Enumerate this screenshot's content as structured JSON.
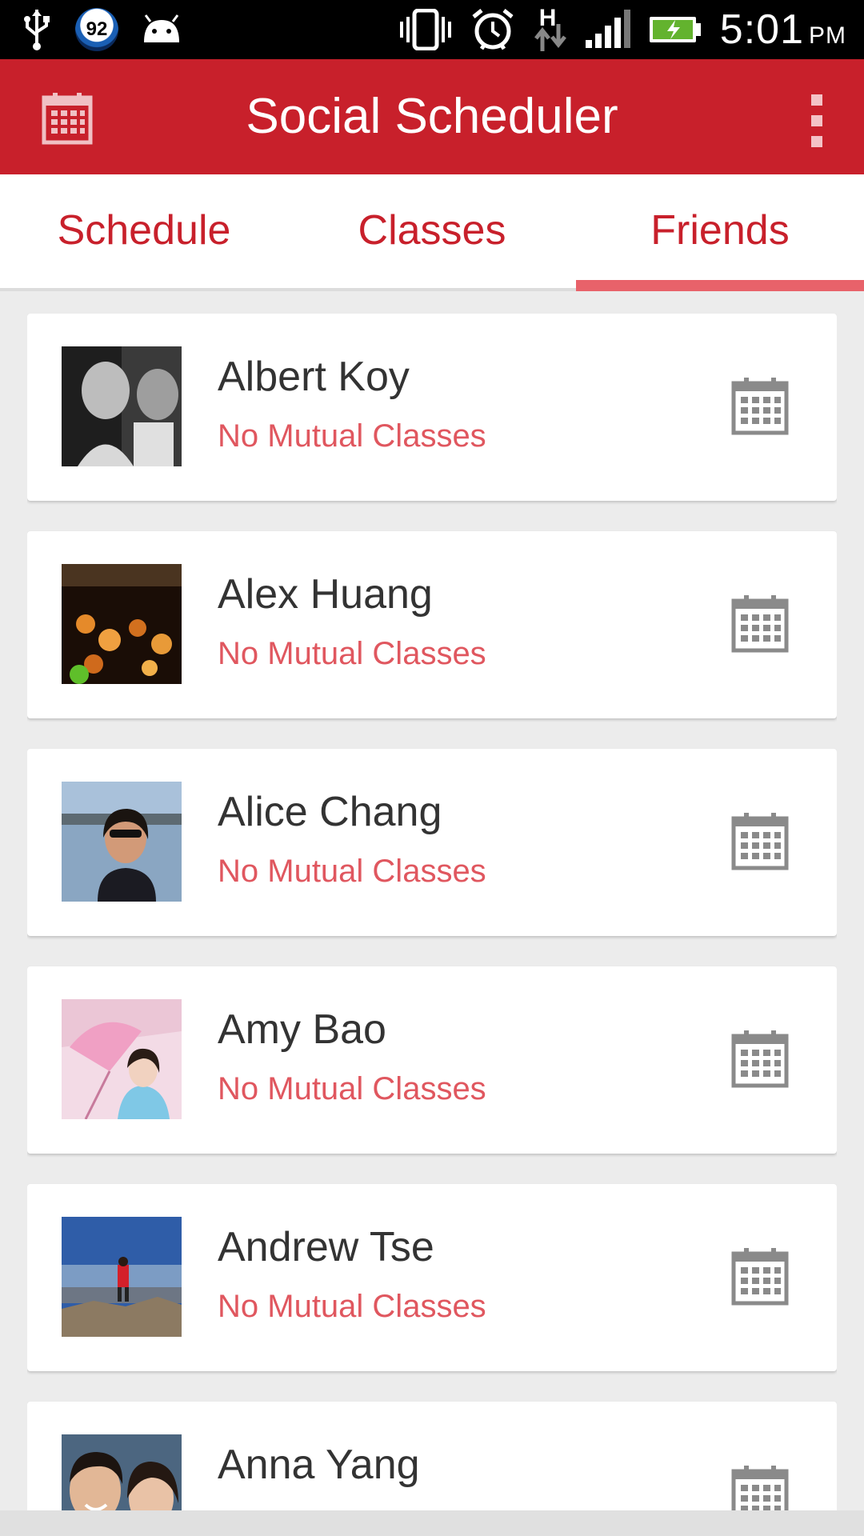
{
  "status_bar": {
    "battery_percent": "92",
    "network_type": "H",
    "time": "5:01",
    "ampm": "PM"
  },
  "app_bar": {
    "title": "Social Scheduler"
  },
  "tabs": [
    {
      "label": "Schedule",
      "active": false
    },
    {
      "label": "Classes",
      "active": false
    },
    {
      "label": "Friends",
      "active": true
    }
  ],
  "friends": [
    {
      "name": "Albert Koy",
      "status": "No Mutual Classes"
    },
    {
      "name": "Alex Huang",
      "status": "No Mutual Classes"
    },
    {
      "name": "Alice Chang",
      "status": "No Mutual Classes"
    },
    {
      "name": "Amy Bao",
      "status": "No Mutual Classes"
    },
    {
      "name": "Andrew Tse",
      "status": "No Mutual Classes"
    },
    {
      "name": "Anna Yang",
      "status": ""
    }
  ],
  "colors": {
    "primary": "#c8202b",
    "accent": "#e8626a",
    "subtitle": "#e0575f"
  }
}
